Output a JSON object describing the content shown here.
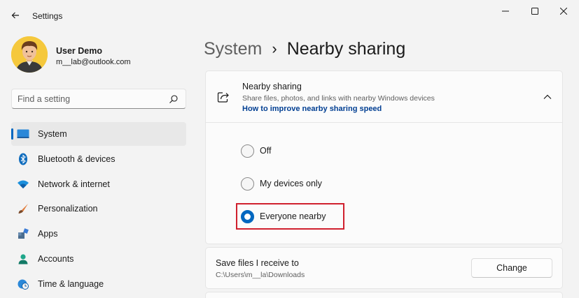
{
  "window": {
    "title": "Settings"
  },
  "profile": {
    "name": "User Demo",
    "email": "m__lab@outlook.com"
  },
  "search": {
    "placeholder": "Find a setting"
  },
  "sidebar": {
    "items": [
      {
        "label": "System",
        "icon": "system-icon",
        "active": true
      },
      {
        "label": "Bluetooth & devices",
        "icon": "bluetooth-icon",
        "active": false
      },
      {
        "label": "Network & internet",
        "icon": "wifi-icon",
        "active": false
      },
      {
        "label": "Personalization",
        "icon": "brush-icon",
        "active": false
      },
      {
        "label": "Apps",
        "icon": "apps-icon",
        "active": false
      },
      {
        "label": "Accounts",
        "icon": "person-icon",
        "active": false
      },
      {
        "label": "Time & language",
        "icon": "globe-clock-icon",
        "active": false
      }
    ]
  },
  "breadcrumb": {
    "parent": "System",
    "separator": "›",
    "current": "Nearby sharing"
  },
  "nearby_card": {
    "title": "Nearby sharing",
    "description": "Share files, photos, and links with nearby Windows devices",
    "link": "How to improve nearby sharing speed",
    "options": [
      {
        "label": "Off",
        "checked": false
      },
      {
        "label": "My devices only",
        "checked": false
      },
      {
        "label": "Everyone nearby",
        "checked": true
      }
    ]
  },
  "save_card": {
    "title": "Save files I receive to",
    "path": "C:\\Users\\m__la\\Downloads",
    "button_label": "Change"
  },
  "colors": {
    "accent": "#0067c0",
    "highlight": "#d0202e",
    "link": "#003e92"
  }
}
